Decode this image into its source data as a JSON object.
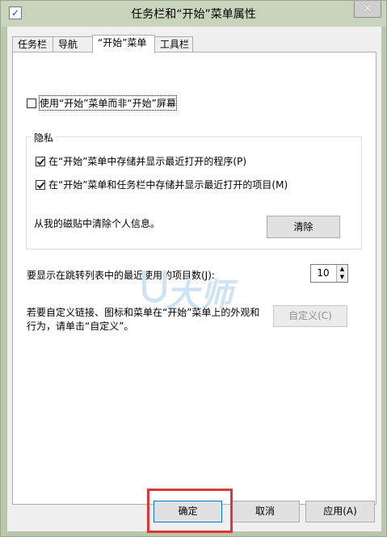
{
  "window": {
    "title": "任务栏和“开始”菜单属性",
    "close_glyph": "✕"
  },
  "tabs": [
    "任务栏",
    "导航",
    "“开始”菜单",
    "工具栏"
  ],
  "start_menu": {
    "use_start_instead_label": "使用“开始”菜单而非“开始”屏幕",
    "use_start_instead_checked": false,
    "privacy": {
      "legend": "隐私",
      "store_recent_programs_label": "在“开始”菜单中存储并显示最近打开的程序(P)",
      "store_recent_programs_checked": true,
      "store_recent_items_label": "在“开始”菜单和任务栏中存储并显示最近打开的项目(M)",
      "store_recent_items_checked": true,
      "clear_tiles_text": "从我的磁贴中清除个人信息。",
      "clear_button": "清除"
    },
    "jump_list_label": "要显示在跳转列表中的最近使用的项目数(J):",
    "jump_list_count": "10",
    "customize_text_line1": "若要自定义链接、图标和菜单在“开始”菜单上的外观和",
    "customize_text_line2": "行为，请单击“自定义”。",
    "customize_button": "自定义(C)"
  },
  "footer": {
    "ok": "确定",
    "cancel": "取消",
    "apply": "应用(A)"
  },
  "watermark": "大师",
  "colors": {
    "highlight": "#e0353a",
    "accent": "#1c4fa0"
  }
}
